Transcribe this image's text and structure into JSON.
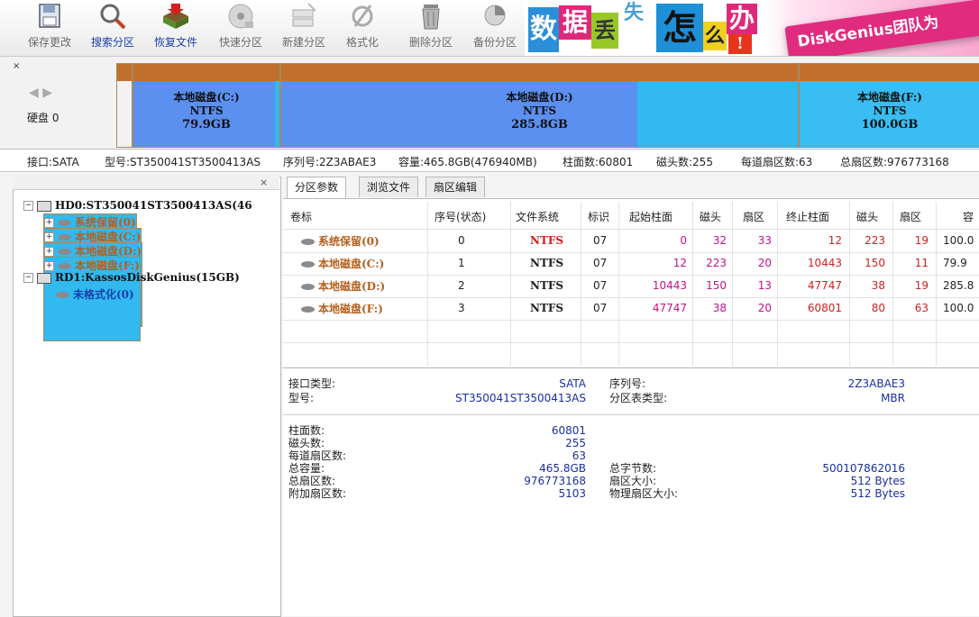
{
  "toolbar": {
    "buttons": [
      {
        "label": "保存更改",
        "icon": "save-disk-icon"
      },
      {
        "label": "搜索分区",
        "icon": "search-icon"
      },
      {
        "label": "恢复文件",
        "icon": "recover-files-icon"
      },
      {
        "label": "快速分区",
        "icon": "quick-partition-icon"
      },
      {
        "label": "新建分区",
        "icon": "new-partition-icon"
      },
      {
        "label": "格式化",
        "icon": "format-icon"
      },
      {
        "label": "删除分区",
        "icon": "trash-icon"
      },
      {
        "label": "备份分区",
        "icon": "backup-icon"
      }
    ]
  },
  "banner": {
    "chars": [
      "数",
      "据",
      "丢",
      "失",
      "怎",
      "么",
      "办",
      "!"
    ],
    "logo_text": "DiskGenius团队为"
  },
  "disk_map": {
    "nav": "◀ ▶",
    "disk_label": "硬盘 0",
    "partitions": [
      {
        "name": "本地磁盘(C:)",
        "fs": "NTFS",
        "size": "79.9GB"
      },
      {
        "name": "本地磁盘(D:)",
        "fs": "NTFS",
        "size": "285.8GB"
      },
      {
        "name": "本地磁盘(F:)",
        "fs": "NTFS",
        "size": "100.0GB"
      }
    ]
  },
  "info_line": {
    "interface": "接口:SATA",
    "model": "型号:ST350041ST3500413AS",
    "serial": "序列号:2Z3ABAE3",
    "capacity": "容量:465.8GB(476940MB)",
    "cylinders": "柱面数:60801",
    "heads": "磁头数:255",
    "sectors_per_track": "每道扇区数:63",
    "total_sectors": "总扇区数:976773168"
  },
  "tree": {
    "items": [
      {
        "text": "HD0:ST350041ST3500413AS(46",
        "kind": "disk",
        "expander": "−"
      },
      {
        "text": "系统保留(0)",
        "kind": "part",
        "expander": "+"
      },
      {
        "text": "本地磁盘(C:)",
        "kind": "part",
        "expander": "+"
      },
      {
        "text": "本地磁盘(D:)",
        "kind": "part",
        "expander": "+"
      },
      {
        "text": "本地磁盘(F:)",
        "kind": "part",
        "expander": "+"
      },
      {
        "text": "RD1:KassosDiskGenius(15GB)",
        "kind": "disk",
        "expander": "−"
      },
      {
        "text": "未格式化(0)",
        "kind": "unf",
        "expander": ""
      }
    ],
    "close": "×"
  },
  "tabs": [
    "分区参数",
    "浏览文件",
    "扇区编辑"
  ],
  "table": {
    "headers": [
      "卷标",
      "序号(状态)",
      "文件系统",
      "标识",
      "起始柱面",
      "磁头",
      "扇区",
      "终止柱面",
      "磁头",
      "扇区",
      "容"
    ],
    "rows": [
      [
        "系统保留(0)",
        "0",
        "NTFS",
        "07",
        "0",
        "32",
        "33",
        "12",
        "223",
        "19",
        "100.0"
      ],
      [
        "本地磁盘(C:)",
        "1",
        "NTFS",
        "07",
        "12",
        "223",
        "20",
        "10443",
        "150",
        "11",
        "79.9"
      ],
      [
        "本地磁盘(D:)",
        "2",
        "NTFS",
        "07",
        "10443",
        "150",
        "13",
        "47747",
        "38",
        "19",
        "285.8"
      ],
      [
        "本地磁盘(F:)",
        "3",
        "NTFS",
        "07",
        "47747",
        "38",
        "20",
        "60801",
        "80",
        "63",
        "100.0"
      ]
    ]
  },
  "details": {
    "interface_type_label": "接口类型:",
    "interface_type": "SATA",
    "model_label": "型号:",
    "model": "ST350041ST3500413AS",
    "serial_label": "序列号:",
    "serial": "2Z3ABAE3",
    "pt_type_label": "分区表类型:",
    "pt_type": "MBR",
    "cyl_label": "柱面数:",
    "cyl": "60801",
    "heads_label": "磁头数:",
    "heads": "255",
    "spt_label": "每道扇区数:",
    "spt": "63",
    "cap_label": "总容量:",
    "cap": "465.8GB",
    "sectors_label": "总扇区数:",
    "sectors": "976773168",
    "extra_label": "附加扇区数:",
    "extra": "5103",
    "bytes_label": "总字节数:",
    "bytes": "500107862016",
    "sector_size_label": "扇区大小:",
    "sector_size": "512 Bytes",
    "phys_label": "物理扇区大小:",
    "phys": "512 Bytes"
  }
}
